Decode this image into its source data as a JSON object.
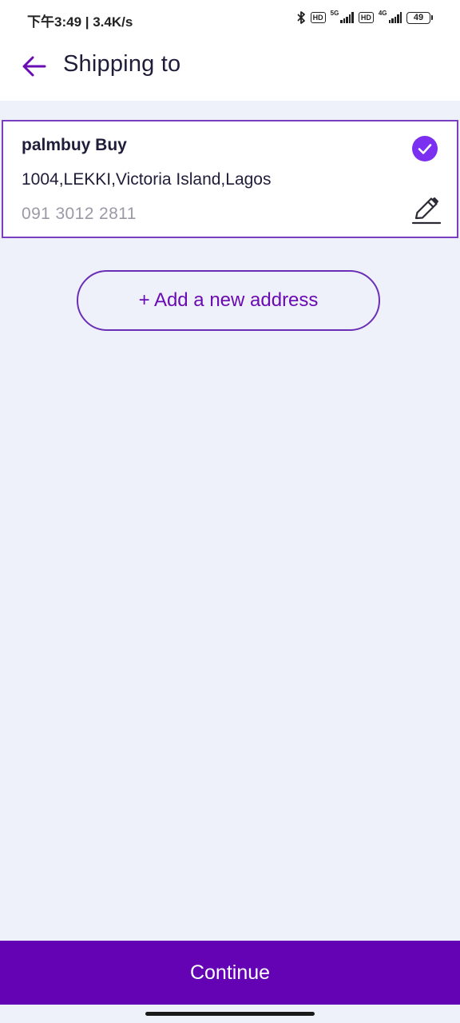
{
  "status_bar": {
    "time": "下午3:49 | 3.4K/s",
    "hd_badge_1": "HD",
    "network_1": "5G",
    "hd_badge_2": "HD",
    "network_2": "4G",
    "battery_level": "49"
  },
  "header": {
    "title": "Shipping to",
    "back_icon": "arrow-left-icon"
  },
  "address": {
    "name": "palmbuy Buy",
    "line": "1004,LEKKI,Victoria Island,Lagos",
    "phone": "091 3012 2811",
    "selected_icon": "check-circle-icon",
    "edit_icon": "pencil-icon"
  },
  "add_address_label": "+ Add a new address",
  "continue_label": "Continue",
  "colors": {
    "primary": "#6303b3",
    "accent": "#7b2ff0",
    "background": "#eff1fa",
    "text": "#1f1d3a",
    "muted": "#9a9aa6"
  }
}
